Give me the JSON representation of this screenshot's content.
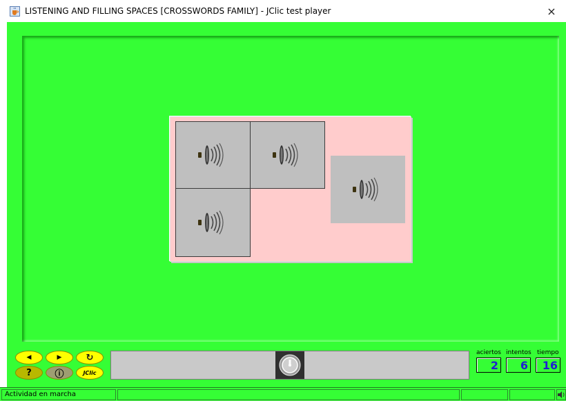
{
  "window": {
    "title": "LISTENING AND FILLING SPACES [CROSSWORDS FAMILY] - JClic test player",
    "close_glyph": "×",
    "app_icon": "java-cup-icon"
  },
  "colors": {
    "player_bg": "#35fe35",
    "board_bg": "#ffcccc",
    "cell_bg": "#bfbfbf",
    "button_yellow": "#ffff00",
    "counter_text": "#2020d0"
  },
  "board": {
    "cells": [
      {
        "icon": "speaker-sound-icon",
        "framed": true
      },
      {
        "icon": "speaker-sound-icon",
        "framed": true
      },
      {
        "icon": "speaker-sound-icon",
        "framed": true
      },
      {
        "icon": "speaker-sound-icon",
        "framed": false
      }
    ]
  },
  "controls": {
    "prev": {
      "icon": "arrow-left-icon",
      "glyph": "◀"
    },
    "next": {
      "icon": "arrow-right-icon",
      "glyph": "▶"
    },
    "restart": {
      "icon": "refresh-icon",
      "glyph": "↻"
    },
    "help": {
      "icon": "help-icon",
      "glyph": "?"
    },
    "info": {
      "icon": "info-icon",
      "glyph": "ⓘ"
    },
    "jclic": {
      "icon": "jclic-logo",
      "label": "JClic"
    }
  },
  "counters": {
    "aciertos": {
      "label": "aciertos",
      "value": "2"
    },
    "intentos": {
      "label": "intentos",
      "value": "6"
    },
    "tiempo": {
      "label": "tiempo",
      "value": "16"
    }
  },
  "status": {
    "message": "Actividad en marcha",
    "sound_icon": "speaker-icon"
  }
}
